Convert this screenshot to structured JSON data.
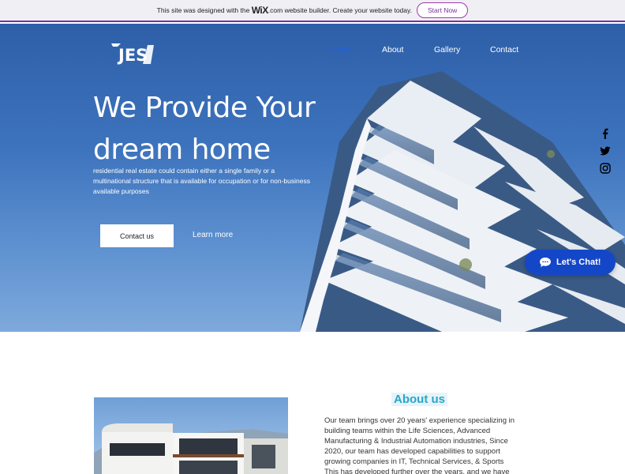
{
  "wix_banner": {
    "prefix": "This site was designed with the",
    "brand": "WiX",
    "brand_suffix": ".com",
    "suffix": "website builder. Create your website today.",
    "start_button": "Start Now"
  },
  "logo": {
    "text": "JES"
  },
  "nav": {
    "items": [
      {
        "label": "Home",
        "active": true
      },
      {
        "label": "About"
      },
      {
        "label": "Gallery"
      },
      {
        "label": "Contact"
      }
    ],
    "active_color": "#1f5fe0"
  },
  "hero": {
    "headline_line1": "We Provide Your",
    "headline_line2": "dream home",
    "subtext": "residential real estate could contain either a single family or a multinational structure that is available for occupation or for non-business available purposes",
    "contact_button": "Contact us",
    "learn_more": "Learn more"
  },
  "social": {
    "icons": [
      "facebook-icon",
      "twitter-icon",
      "instagram-icon"
    ]
  },
  "chat": {
    "label": "Let's Chat!",
    "color": "#1447c8"
  },
  "about": {
    "title": "About us",
    "title_color": "#2aa5c9",
    "line1": "Our team brings over 20 years' experience specializing in",
    "line2": "building teams within the Life Sciences, Advanced",
    "line3": "Manufacturing & Industrial Automation industries, Since",
    "line4": "2020, our team has developed capabilities to support",
    "line5": "growing companies  in IT, Technical Services, & Sports",
    "line6": "This has developed further over the years, and we have"
  }
}
